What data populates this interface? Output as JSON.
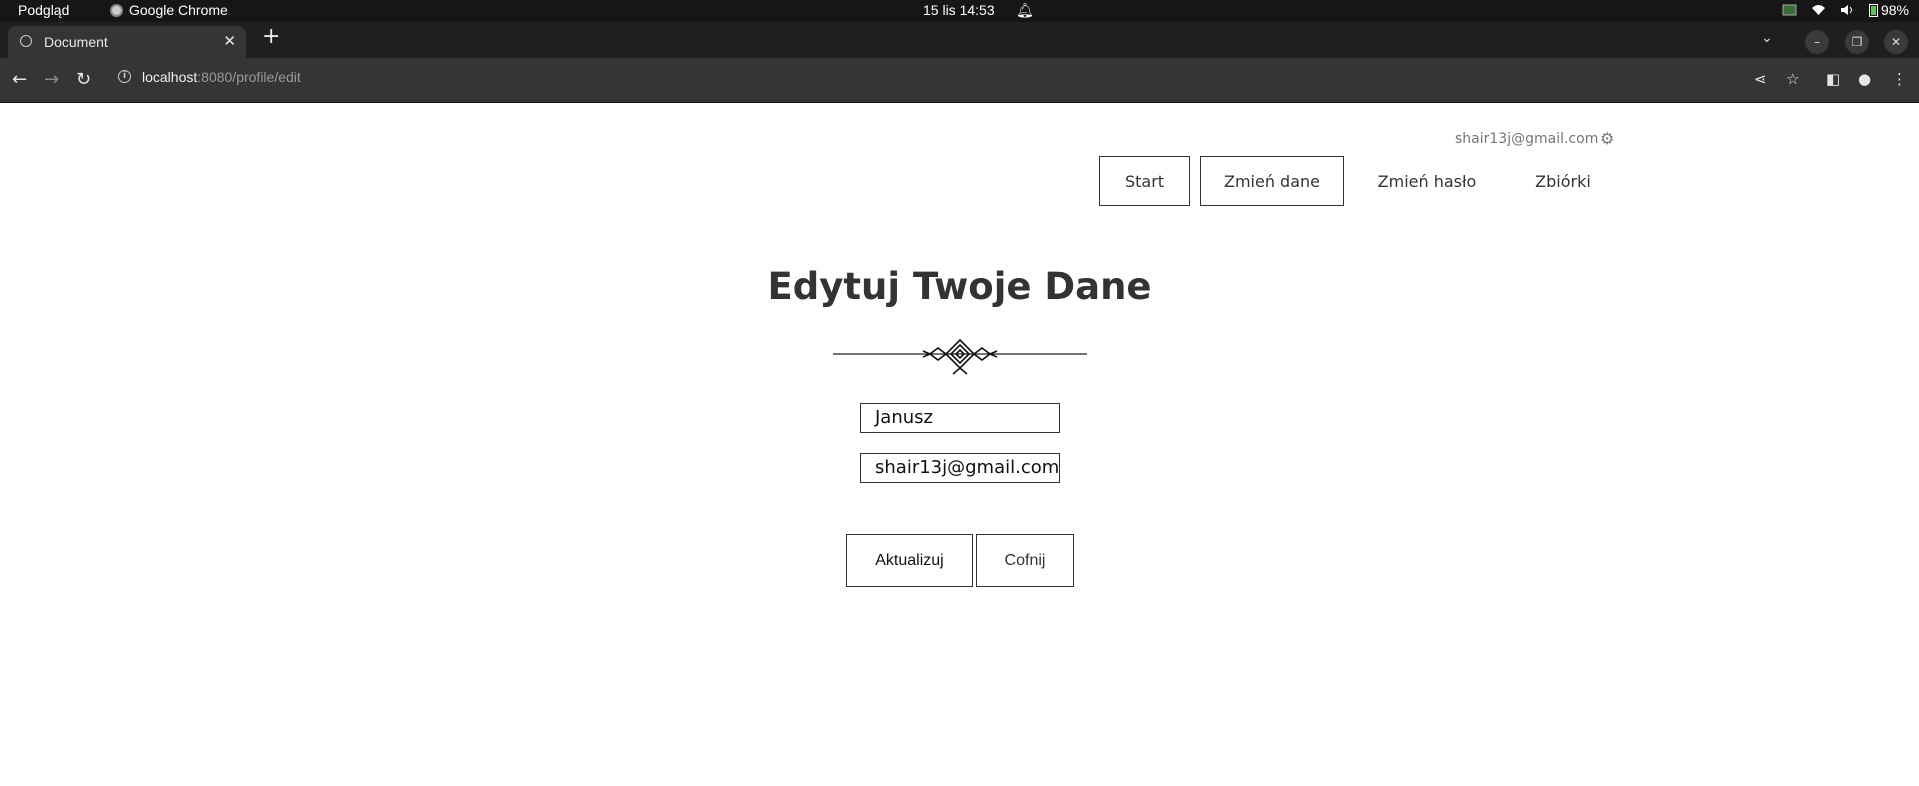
{
  "os_bar": {
    "app_menu": "Podgląd",
    "active_app": "Google Chrome",
    "clock": "15 lis  14:53",
    "battery": "98%"
  },
  "browser": {
    "tab_title": "Document",
    "url_host": "localhost",
    "url_rest": ":8080/profile/edit"
  },
  "header": {
    "user_email": "shair13j@gmail.com",
    "nav": [
      {
        "label": "Start"
      },
      {
        "label": "Zmień dane"
      },
      {
        "label": "Zmień hasło"
      },
      {
        "label": "Zbiórki"
      }
    ]
  },
  "form": {
    "title": "Edytuj Twoje Dane",
    "name_value": "Janusz",
    "email_value": "shair13j@gmail.com",
    "submit_label": "Aktualizuj",
    "back_label": "Cofnij"
  }
}
